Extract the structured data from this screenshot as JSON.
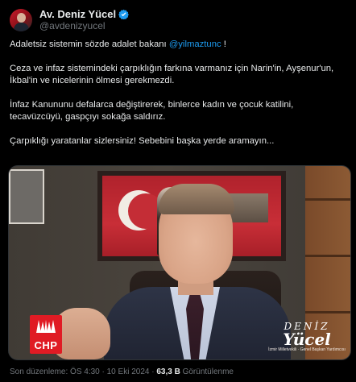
{
  "author": {
    "display_name": "Av. Deniz Yücel",
    "handle": "@avdenizyucel",
    "verified_icon": "verified-badge-icon",
    "badge_color": "#1d9bf0"
  },
  "tweet": {
    "line1_prefix": "Adaletsiz sistemin sözde adalet bakanı ",
    "line1_mention": "@yilmaztunc",
    "line1_suffix": " !",
    "para2_line1": "Ceza ve infaz sistemindeki çarpıklığın farkına varmanız için Narin'in, Ayşenur'un,",
    "para2_line2": "İkbal'in ve nicelerinin ölmesi gerekmezdi.",
    "para3_line1": "İnfaz Kanununu defalarca değiştirerek, binlerce kadın ve çocuk katilini,",
    "para3_line2": "tecavüzcüyü, gaspçıyı sokağa saldırız.",
    "para4": "Çarpıklığı yaratanlar sizlersiniz! Sebebini başka yerde aramayın..."
  },
  "video": {
    "party_logo_text": "CHP",
    "party_color": "#e01b24",
    "brand_first": "DENİZ",
    "brand_last": "Yücel",
    "brand_sub": "İzmir Milletvekili · Genel Başkan Yardımcısı"
  },
  "footer": {
    "edited_label": "Son düzenleme: ÖS 4:30 · 10 Eki 2024 · ",
    "views_count": "63,3 B",
    "views_label": " Görüntülenme"
  },
  "colors": {
    "background": "#000000",
    "text": "#e7e9ea",
    "secondary_text": "#71767b",
    "link": "#1d9bf0"
  }
}
